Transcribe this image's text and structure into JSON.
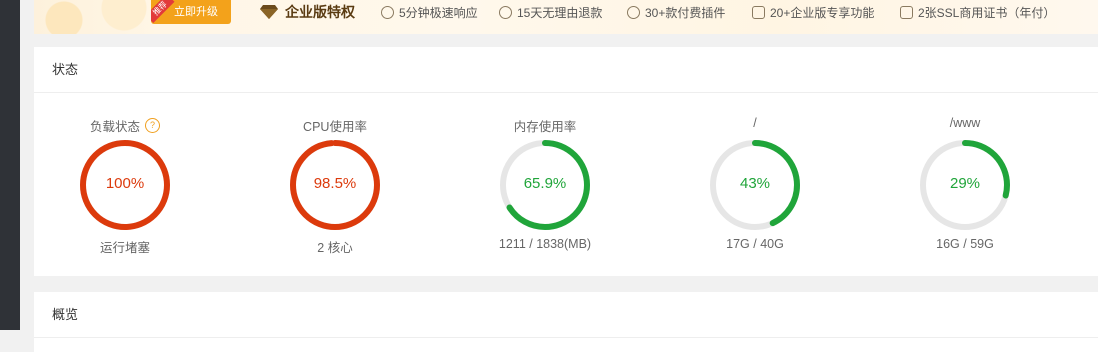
{
  "banner": {
    "upgrade_tag": "推荐",
    "upgrade_label": "立即升级",
    "enterprise_title": "企业版特权",
    "features": [
      {
        "icon": "clock-icon",
        "label": "5分钟极速响应"
      },
      {
        "icon": "refund-icon",
        "label": "15天无理由退款"
      },
      {
        "icon": "plugin-icon",
        "label": "30+款付费插件"
      },
      {
        "icon": "diamond-icon",
        "label": "20+企业版专享功能"
      },
      {
        "icon": "ssl-icon",
        "label": "2张SSL商用证书（年付）"
      }
    ]
  },
  "status": {
    "title": "状态",
    "gauges": [
      {
        "label": "负载状态",
        "value_text": "100%",
        "percent": 100,
        "sub": "运行堵塞",
        "color": "#dc3a0c",
        "help": "?"
      },
      {
        "label": "CPU使用率",
        "value_text": "98.5%",
        "percent": 98.5,
        "sub": "2 核心",
        "color": "#dc3a0c"
      },
      {
        "label": "内存使用率",
        "value_text": "65.9%",
        "percent": 65.9,
        "sub": "1211 / 1838(MB)",
        "color": "#20a53a"
      },
      {
        "label": "/",
        "value_text": "43%",
        "percent": 43,
        "sub": "17G / 40G",
        "color": "#20a53a"
      },
      {
        "label": "/www",
        "value_text": "29%",
        "percent": 29,
        "sub": "16G / 59G",
        "color": "#20a53a"
      }
    ]
  },
  "overview": {
    "title": "概览"
  },
  "colors": {
    "track": "#e6e6e6",
    "danger": "#dc3a0c",
    "ok": "#20a53a",
    "accent": "#f3a21b"
  }
}
